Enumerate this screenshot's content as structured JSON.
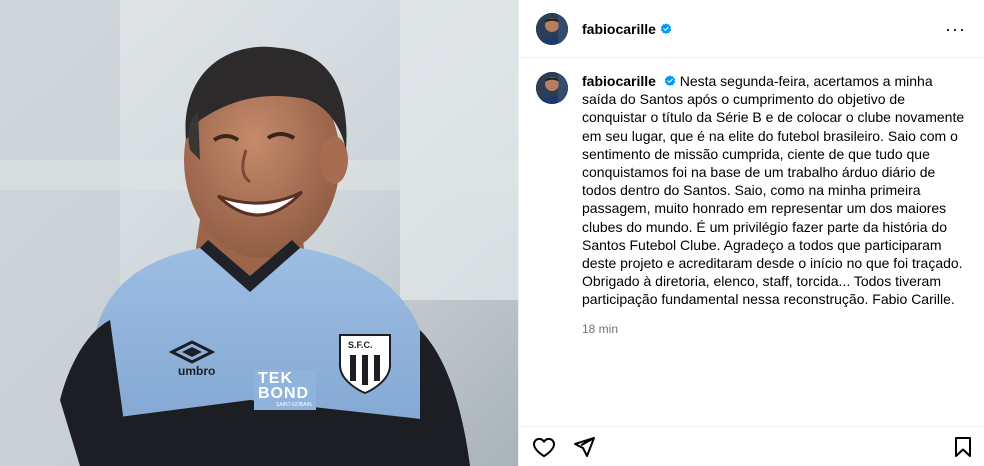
{
  "post": {
    "image_alt": "Fabio Carille smiling in Santos training shirt",
    "shirt_sponsor_line1": "TEK",
    "shirt_sponsor_line2": "BOND",
    "shirt_sponsor_sub": "SAINT-GOBAIN",
    "shirt_brand": "umbro",
    "crest_text": "S.F.C."
  },
  "header": {
    "username": "fabiocarille",
    "more_label": "···"
  },
  "caption": {
    "username": "fabiocarille",
    "text": "Nesta segunda-feira, acertamos a minha saída do Santos após o cumprimento do objetivo de conquistar o título da Série B e de colocar o clube novamente em seu lugar, que é na elite do futebol brasileiro. Saio com o sentimento de missão cumprida, ciente de que tudo que conquistamos foi na base de um trabalho árduo diário de todos dentro do Santos. Saio, como na minha primeira passagem, muito honrado em representar um dos maiores clubes do mundo. É um privilégio fazer parte da história do Santos Futebol Clube. Agradeço a todos que participaram deste projeto e acreditaram desde o início no que foi traçado. Obrigado à diretoria, elenco, staff, torcida... Todos tiveram participação fundamental nessa reconstrução. Fabio Carille.",
    "timestamp": "18 min"
  },
  "actions": {
    "like_icon": "heart-icon",
    "share_icon": "paper-plane-icon",
    "save_icon": "bookmark-icon"
  },
  "colors": {
    "verified": "#0095f6",
    "shirt_blue": "#8fb3dc",
    "shirt_dark": "#1a1c22",
    "muted_text": "#737373",
    "divider": "#efefef"
  }
}
